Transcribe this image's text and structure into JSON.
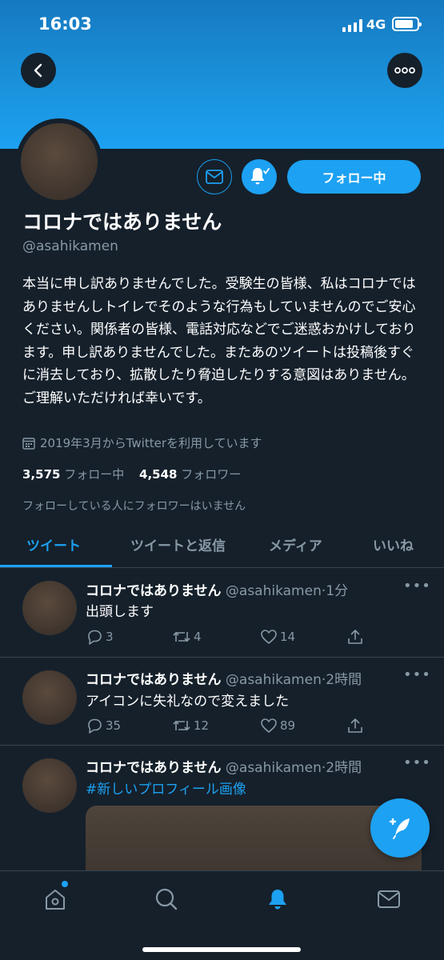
{
  "status_bar": {
    "time": "16:03",
    "network": "4G"
  },
  "profile": {
    "name": "コロナではありません",
    "handle": "@asahikamen",
    "follow_button": "フォロー中",
    "bio": "本当に申し訳ありませんでした。受験生の皆様、私はコロナではありませんしトイレでそのような行為もしていませんのでご安心ください。関係者の皆様、電話対応などでご迷惑おかけしております。申し訳ありませんでした。またあのツイートは投稿後すぐに消去しており、拡散したり脅迫したりする意図はありません。ご理解いただければ幸いです。",
    "joined": "2019年3月からTwitterを利用しています",
    "following_count": "3,575",
    "following_label": "フォロー中",
    "followers_count": "4,548",
    "followers_label": "フォロワー",
    "followers_note": "フォローしている人にフォロワーはいません"
  },
  "tabs": [
    {
      "label": "ツイート",
      "active": true
    },
    {
      "label": "ツイートと返信",
      "active": false
    },
    {
      "label": "メディア",
      "active": false
    },
    {
      "label": "いいね",
      "active": false
    }
  ],
  "tweets": [
    {
      "name": "コロナではありません",
      "handle": "@asahikamen",
      "time": "1分",
      "text": "出頭します",
      "replies": "3",
      "retweets": "4",
      "likes": "14"
    },
    {
      "name": "コロナではありません",
      "handle": "@asahikamen",
      "time": "2時間",
      "text": "アイコンに失礼なので変えました",
      "replies": "35",
      "retweets": "12",
      "likes": "89"
    },
    {
      "name": "コロナではありません",
      "handle": "@asahikamen",
      "time": "2時間",
      "text": "#新しいプロフィール画像"
    }
  ],
  "icons": {
    "back": "chevron-left-icon",
    "more": "ellipsis-icon",
    "mail": "mail-icon",
    "bell": "bell-icon",
    "calendar": "calendar-icon",
    "reply": "reply-icon",
    "retweet": "retweet-icon",
    "like": "heart-icon",
    "share": "share-icon",
    "compose": "compose-icon",
    "home": "home-icon",
    "search": "search-icon"
  },
  "colors": {
    "accent": "#1da1f2",
    "background": "#15202b",
    "secondary_text": "#8899a6",
    "divider": "#38444d"
  }
}
